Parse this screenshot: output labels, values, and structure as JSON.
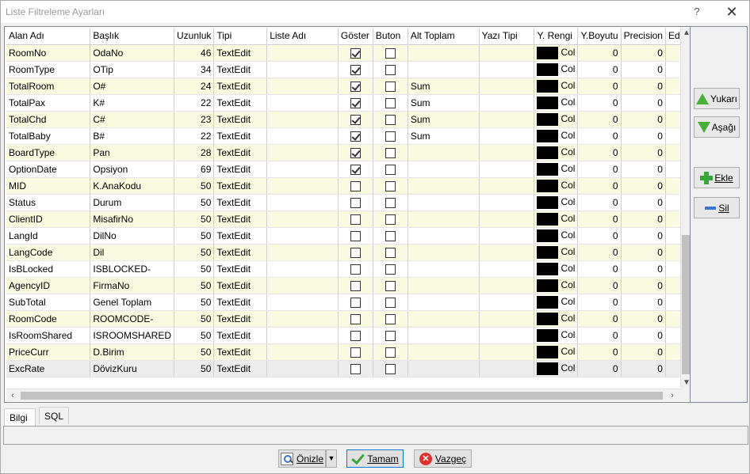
{
  "window": {
    "title": "Liste Filtreleme Ayarları",
    "help": "?",
    "close": "✕"
  },
  "grid": {
    "headers": [
      "Alan Adı",
      "Başlık",
      "Uzunluk",
      "Tipi",
      "Liste Adı",
      "Göster",
      "Buton",
      "Alt Toplam",
      "Yazı Tipi",
      "Y. Rengi",
      "Y.Boyutu",
      "Precision",
      "Edit"
    ],
    "rows": [
      {
        "alan": "RoomNo",
        "baslik": "OdaNo",
        "uzunluk": "46",
        "tipi": "TextEdit",
        "liste": "",
        "goster": true,
        "buton": false,
        "alt": "",
        "yazi": "",
        "renk": "Col",
        "boyut": "0",
        "precision": "0"
      },
      {
        "alan": "RoomType",
        "baslik": "OTip",
        "uzunluk": "34",
        "tipi": "TextEdit",
        "liste": "",
        "goster": true,
        "buton": false,
        "alt": "",
        "yazi": "",
        "renk": "Col",
        "boyut": "0",
        "precision": "0"
      },
      {
        "alan": "TotalRoom",
        "baslik": "O#",
        "uzunluk": "24",
        "tipi": "TextEdit",
        "liste": "",
        "goster": true,
        "buton": false,
        "alt": "Sum",
        "yazi": "",
        "renk": "Col",
        "boyut": "0",
        "precision": "0"
      },
      {
        "alan": "TotalPax",
        "baslik": "K#",
        "uzunluk": "22",
        "tipi": "TextEdit",
        "liste": "",
        "goster": true,
        "buton": false,
        "alt": "Sum",
        "yazi": "",
        "renk": "Col",
        "boyut": "0",
        "precision": "0"
      },
      {
        "alan": "TotalChd",
        "baslik": "C#",
        "uzunluk": "23",
        "tipi": "TextEdit",
        "liste": "",
        "goster": true,
        "buton": false,
        "alt": "Sum",
        "yazi": "",
        "renk": "Col",
        "boyut": "0",
        "precision": "0"
      },
      {
        "alan": "TotalBaby",
        "baslik": "B#",
        "uzunluk": "22",
        "tipi": "TextEdit",
        "liste": "",
        "goster": true,
        "buton": false,
        "alt": "Sum",
        "yazi": "",
        "renk": "Col",
        "boyut": "0",
        "precision": "0"
      },
      {
        "alan": "BoardType",
        "baslik": "Pan",
        "uzunluk": "28",
        "tipi": "TextEdit",
        "liste": "",
        "goster": true,
        "buton": false,
        "alt": "",
        "yazi": "",
        "renk": "Col",
        "boyut": "0",
        "precision": "0"
      },
      {
        "alan": "OptionDate",
        "baslik": "Opsiyon",
        "uzunluk": "69",
        "tipi": "TextEdit",
        "liste": "",
        "goster": true,
        "buton": false,
        "alt": "",
        "yazi": "",
        "renk": "Col",
        "boyut": "0",
        "precision": "0"
      },
      {
        "alan": "MID",
        "baslik": "K.AnaKodu",
        "uzunluk": "50",
        "tipi": "TextEdit",
        "liste": "",
        "goster": false,
        "buton": false,
        "alt": "",
        "yazi": "",
        "renk": "Col",
        "boyut": "0",
        "precision": "0"
      },
      {
        "alan": "Status",
        "baslik": "Durum",
        "uzunluk": "50",
        "tipi": "TextEdit",
        "liste": "",
        "goster": false,
        "buton": false,
        "alt": "",
        "yazi": "",
        "renk": "Col",
        "boyut": "0",
        "precision": "0"
      },
      {
        "alan": "ClientID",
        "baslik": "MisafirNo",
        "uzunluk": "50",
        "tipi": "TextEdit",
        "liste": "",
        "goster": false,
        "buton": false,
        "alt": "",
        "yazi": "",
        "renk": "Col",
        "boyut": "0",
        "precision": "0"
      },
      {
        "alan": "LangId",
        "baslik": "DilNo",
        "uzunluk": "50",
        "tipi": "TextEdit",
        "liste": "",
        "goster": false,
        "buton": false,
        "alt": "",
        "yazi": "",
        "renk": "Col",
        "boyut": "0",
        "precision": "0"
      },
      {
        "alan": "LangCode",
        "baslik": "Dil",
        "uzunluk": "50",
        "tipi": "TextEdit",
        "liste": "",
        "goster": false,
        "buton": false,
        "alt": "",
        "yazi": "",
        "renk": "Col",
        "boyut": "0",
        "precision": "0"
      },
      {
        "alan": "IsBLocked",
        "baslik": "ISBLOCKED-",
        "uzunluk": "50",
        "tipi": "TextEdit",
        "liste": "",
        "goster": false,
        "buton": false,
        "alt": "",
        "yazi": "",
        "renk": "Col",
        "boyut": "0",
        "precision": "0"
      },
      {
        "alan": "AgencyID",
        "baslik": "FirmaNo",
        "uzunluk": "50",
        "tipi": "TextEdit",
        "liste": "",
        "goster": false,
        "buton": false,
        "alt": "",
        "yazi": "",
        "renk": "Col",
        "boyut": "0",
        "precision": "0"
      },
      {
        "alan": "SubTotal",
        "baslik": "Genel Toplam",
        "uzunluk": "50",
        "tipi": "TextEdit",
        "liste": "",
        "goster": false,
        "buton": false,
        "alt": "",
        "yazi": "",
        "renk": "Col",
        "boyut": "0",
        "precision": "0"
      },
      {
        "alan": "RoomCode",
        "baslik": "ROOMCODE-",
        "uzunluk": "50",
        "tipi": "TextEdit",
        "liste": "",
        "goster": false,
        "buton": false,
        "alt": "",
        "yazi": "",
        "renk": "Col",
        "boyut": "0",
        "precision": "0"
      },
      {
        "alan": "IsRoomShared",
        "baslik": "ISROOMSHARED",
        "uzunluk": "50",
        "tipi": "TextEdit",
        "liste": "",
        "goster": false,
        "buton": false,
        "alt": "",
        "yazi": "",
        "renk": "Col",
        "boyut": "0",
        "precision": "0"
      },
      {
        "alan": "PriceCurr",
        "baslik": "D.Birim",
        "uzunluk": "50",
        "tipi": "TextEdit",
        "liste": "",
        "goster": false,
        "buton": false,
        "alt": "",
        "yazi": "",
        "renk": "Col",
        "boyut": "0",
        "precision": "0"
      },
      {
        "alan": "ExcRate",
        "baslik": "DövizKuru",
        "uzunluk": "50",
        "tipi": "TextEdit",
        "liste": "",
        "goster": false,
        "buton": false,
        "alt": "",
        "yazi": "",
        "renk": "Col",
        "boyut": "0",
        "precision": "0"
      }
    ]
  },
  "side_buttons": {
    "up": "Yukarı",
    "down": "Aşağı",
    "add": "Ekle",
    "delete": "Sil"
  },
  "tabs": [
    "Bilgi",
    "SQL"
  ],
  "bottom_buttons": {
    "preview": "Önizle",
    "ok": "Tamam",
    "cancel": "Vazgeç"
  },
  "colors": {
    "odd_row": "#fafae0",
    "swatch": "#000000",
    "primary_border": "#0078d7"
  },
  "icons": {
    "up": "arrow-up-icon",
    "down": "arrow-down-icon",
    "add": "plus-icon",
    "delete": "minus-icon",
    "preview": "preview-icon",
    "ok": "check-icon",
    "cancel": "cancel-icon"
  }
}
